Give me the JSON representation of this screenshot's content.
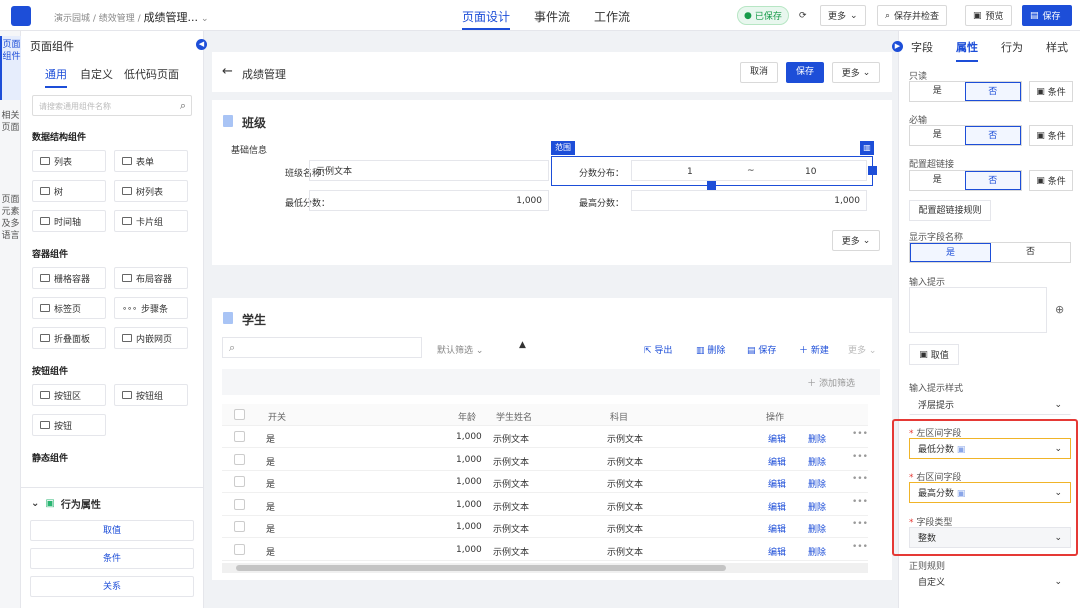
{
  "topbar": {
    "crumb_1": "演示园城",
    "crumb_2": "绩效管理",
    "crumb_3": "成绩管理...",
    "tabs": [
      "页面设计",
      "事件流",
      "工作流"
    ],
    "saved": "已保存",
    "more": "更多",
    "save_check": "保存并检查",
    "preview": "预览",
    "save": "保存"
  },
  "vtabs": [
    "页面组件",
    "相关页面",
    "页面元素及多语言"
  ],
  "components": {
    "title": "页面组件",
    "tabs": [
      "通用",
      "自定义",
      "低代码页面"
    ],
    "search_placeholder": "请搜索通用组件名称",
    "groups": {
      "data": "数据结构组件",
      "container": "容器组件",
      "button": "按钮组件",
      "static": "静态组件"
    },
    "items": [
      "列表",
      "表单",
      "树",
      "树列表",
      "时间轴",
      "卡片组",
      "栅格容器",
      "布局容器",
      "标签页",
      "步骤条",
      "折叠面板",
      "内嵌网页",
      "按钮区",
      "按钮组",
      "按钮"
    ],
    "behavior_title": "行为属性",
    "behavior_btns": [
      "取值",
      "条件",
      "关系"
    ]
  },
  "canvas": {
    "page_title": "成绩管理",
    "cancel": "取消",
    "save": "保存",
    "more": "更多",
    "class_title": "班级",
    "basic_info": "基础信息",
    "range_tag": "范围",
    "class_name_label": "班级名称：",
    "class_name_value": "示例文本",
    "dist_label": "分数分布：",
    "dist_min": "1",
    "dist_sep": "~",
    "dist_max": "10",
    "min_label": "最低分数：",
    "min_value": "1,000",
    "max_label": "最高分数：",
    "max_value": "1,000",
    "more_btn": "更多",
    "student_title": "学生",
    "default_filter": "默认筛选",
    "actions": [
      "导出",
      "删除",
      "保存",
      "新建",
      "更多"
    ],
    "add_filter": "添加筛选",
    "columns": [
      "开关",
      "年龄",
      "学生姓名",
      "科目",
      "操作"
    ],
    "rows": [
      {
        "switch": "是",
        "age": "1,000",
        "name": "示例文本",
        "subject": "示例文本"
      },
      {
        "switch": "是",
        "age": "1,000",
        "name": "示例文本",
        "subject": "示例文本"
      },
      {
        "switch": "是",
        "age": "1,000",
        "name": "示例文本",
        "subject": "示例文本"
      },
      {
        "switch": "是",
        "age": "1,000",
        "name": "示例文本",
        "subject": "示例文本"
      },
      {
        "switch": "是",
        "age": "1,000",
        "name": "示例文本",
        "subject": "示例文本"
      },
      {
        "switch": "是",
        "age": "1,000",
        "name": "示例文本",
        "subject": "示例文本"
      }
    ],
    "edit": "编辑",
    "delete": "删除"
  },
  "props": {
    "tabs": [
      "字段",
      "属性",
      "行为",
      "样式"
    ],
    "readonly": "只读",
    "required": "必输",
    "hyperlink": "配置超链接",
    "yes": "是",
    "no": "否",
    "condition": "条件",
    "hyperlink_rule": "配置超链接规则",
    "show_name": "显示字段名称",
    "input_hint": "输入提示",
    "fetch": "取值",
    "hint_style": "输入提示样式",
    "hint_style_value": "浮层提示",
    "left_field": "左区间字段",
    "left_value": "最低分数",
    "right_field": "右区间字段",
    "right_value": "最高分数",
    "field_type": "字段类型",
    "field_type_value": "整数",
    "regex": "正则规则",
    "regex_value": "自定义"
  },
  "colors": {
    "primary": "#1d4ed8",
    "highlight": "#e53935",
    "selected": "#f0b429"
  }
}
